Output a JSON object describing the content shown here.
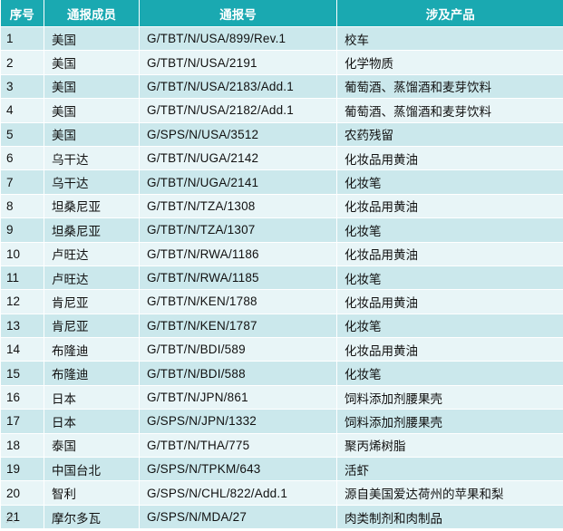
{
  "colors": {
    "header_bg": "#1aa9b1",
    "row_odd": "#cbe8ec",
    "row_even": "#e8f5f7"
  },
  "headers": [
    "序号",
    "通报成员",
    "通报号",
    "涉及产品"
  ],
  "rows": [
    [
      "1",
      "美国",
      "G/TBT/N/USA/899/Rev.1",
      "校车"
    ],
    [
      "2",
      "美国",
      "G/TBT/N/USA/2191",
      "化学物质"
    ],
    [
      "3",
      "美国",
      "G/TBT/N/USA/2183/Add.1",
      "葡萄酒、蒸馏酒和麦芽饮料"
    ],
    [
      "4",
      "美国",
      "G/TBT/N/USA/2182/Add.1",
      "葡萄酒、蒸馏酒和麦芽饮料"
    ],
    [
      "5",
      "美国",
      "G/SPS/N/USA/3512",
      "农药残留"
    ],
    [
      "6",
      "乌干达",
      "G/TBT/N/UGA/2142",
      "化妆品用黄油"
    ],
    [
      "7",
      "乌干达",
      "G/TBT/N/UGA/2141",
      "化妆笔"
    ],
    [
      "8",
      "坦桑尼亚",
      "G/TBT/N/TZA/1308",
      "化妆品用黄油"
    ],
    [
      "9",
      "坦桑尼亚",
      "G/TBT/N/TZA/1307",
      "化妆笔"
    ],
    [
      "10",
      "卢旺达",
      "G/TBT/N/RWA/1186",
      "化妆品用黄油"
    ],
    [
      "11",
      "卢旺达",
      "G/TBT/N/RWA/1185",
      "化妆笔"
    ],
    [
      "12",
      "肯尼亚",
      "G/TBT/N/KEN/1788",
      "化妆品用黄油"
    ],
    [
      "13",
      "肯尼亚",
      "G/TBT/N/KEN/1787",
      "化妆笔"
    ],
    [
      "14",
      "布隆迪",
      "G/TBT/N/BDI/589",
      "化妆品用黄油"
    ],
    [
      "15",
      "布隆迪",
      "G/TBT/N/BDI/588",
      "化妆笔"
    ],
    [
      "16",
      "日本",
      "G/TBT/N/JPN/861",
      "饲料添加剂腰果壳"
    ],
    [
      "17",
      "日本",
      "G/SPS/N/JPN/1332",
      "饲料添加剂腰果壳"
    ],
    [
      "18",
      "泰国",
      "G/TBT/N/THA/775",
      "聚丙烯树脂"
    ],
    [
      "19",
      "中国台北",
      "G/SPS/N/TPKM/643",
      "活虾"
    ],
    [
      "20",
      "智利",
      "G/SPS/N/CHL/822/Add.1",
      "源自美国爱达荷州的苹果和梨"
    ],
    [
      "21",
      "摩尔多瓦",
      "G/SPS/N/MDA/27",
      "肉类制剂和肉制品"
    ]
  ],
  "watermark": "大"
}
